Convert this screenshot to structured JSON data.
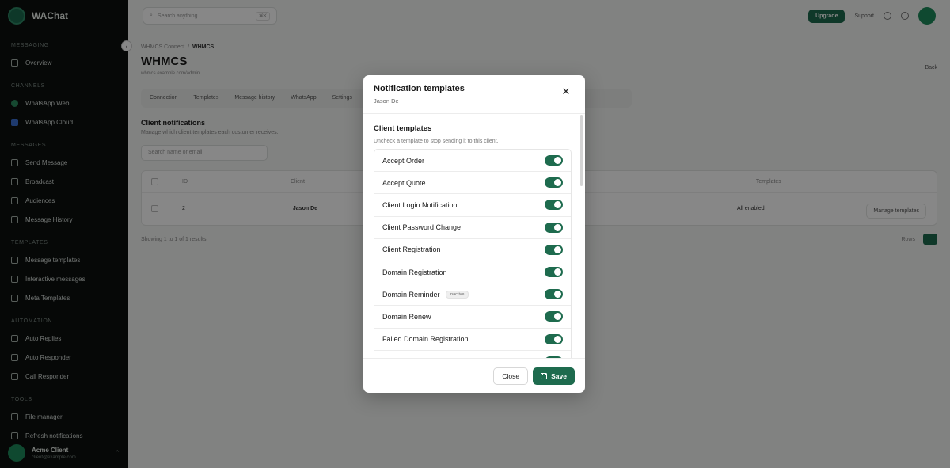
{
  "colors": {
    "accent": "#1e6b4e",
    "sidebar_bg": "#0d100f",
    "overlay": "rgba(0,0,0,0.47)"
  },
  "sidebar": {
    "brand": "WAChat",
    "sections": [
      {
        "label": "MESSAGING",
        "items": [
          {
            "label": "Overview",
            "icon": "grid-icon"
          }
        ]
      },
      {
        "label": "CHANNELS",
        "items": [
          {
            "label": "WhatsApp Web",
            "icon": "whatsapp-icon"
          },
          {
            "label": "WhatsApp Cloud",
            "icon": "cloud-icon"
          }
        ]
      },
      {
        "label": "MESSAGES",
        "items": [
          {
            "label": "Send Message",
            "icon": "send-icon"
          },
          {
            "label": "Broadcast",
            "icon": "broadcast-icon"
          },
          {
            "label": "Audiences",
            "icon": "users-icon"
          },
          {
            "label": "Message History",
            "icon": "history-icon"
          }
        ]
      },
      {
        "label": "TEMPLATES",
        "items": [
          {
            "label": "Message templates",
            "icon": "template-icon"
          },
          {
            "label": "Interactive messages",
            "icon": "interactive-icon"
          },
          {
            "label": "Meta Templates",
            "icon": "meta-icon"
          }
        ]
      },
      {
        "label": "AUTOMATION",
        "items": [
          {
            "label": "Auto Replies",
            "icon": "reply-icon"
          },
          {
            "label": "Auto Responder",
            "icon": "responder-icon"
          },
          {
            "label": "Call Responder",
            "icon": "phone-icon"
          }
        ]
      },
      {
        "label": "TOOLS",
        "items": [
          {
            "label": "File manager",
            "icon": "folder-icon"
          },
          {
            "label": "Refresh notifications",
            "icon": "bell-icon"
          }
        ]
      }
    ],
    "user": {
      "name": "Acme Client",
      "email": "client@example.com"
    }
  },
  "topbar": {
    "search_placeholder": "Search anything...",
    "shortcut": "⌘K",
    "upgrade_label": "Upgrade",
    "help_label": "Support"
  },
  "main": {
    "breadcrumb_parent": "WHMCS Connect",
    "breadcrumb_current": "WHMCS",
    "title": "WHMCS",
    "subtitle": "whmcs.example.com/admin",
    "back_label": "Back",
    "tabs": [
      "Connection",
      "Templates",
      "Message history",
      "WhatsApp",
      "Settings"
    ],
    "section_title": "Client notifications",
    "section_desc": "Manage which client templates each customer receives.",
    "table_search": "Search name or email",
    "table_headers": [
      "ID",
      "Client",
      "Templates"
    ],
    "table_row": {
      "id": "2",
      "name": "Jason De",
      "email": "jason.de@example.com",
      "templates": "All enabled"
    },
    "showing": "Showing 1 to 1 of 1 results",
    "pager_label": "Rows",
    "manage_label": "Manage templates"
  },
  "modal": {
    "title": "Notification templates",
    "subtitle": "Jason De",
    "section_title": "Client templates",
    "section_desc": "Uncheck a template to stop sending it to this client.",
    "templates": [
      {
        "label": "Accept Order",
        "enabled": true,
        "badge": ""
      },
      {
        "label": "Accept Quote",
        "enabled": true,
        "badge": ""
      },
      {
        "label": "Client Login Notification",
        "enabled": true,
        "badge": ""
      },
      {
        "label": "Client Password Change",
        "enabled": true,
        "badge": ""
      },
      {
        "label": "Client Registration",
        "enabled": true,
        "badge": ""
      },
      {
        "label": "Domain Registration",
        "enabled": true,
        "badge": ""
      },
      {
        "label": "Domain Reminder",
        "enabled": true,
        "badge": "Inactive"
      },
      {
        "label": "Domain Renew",
        "enabled": true,
        "badge": ""
      },
      {
        "label": "Failed Domain Registration",
        "enabled": true,
        "badge": ""
      },
      {
        "label": "",
        "enabled": true,
        "badge": ""
      }
    ],
    "close_label": "Close",
    "save_label": "Save"
  }
}
